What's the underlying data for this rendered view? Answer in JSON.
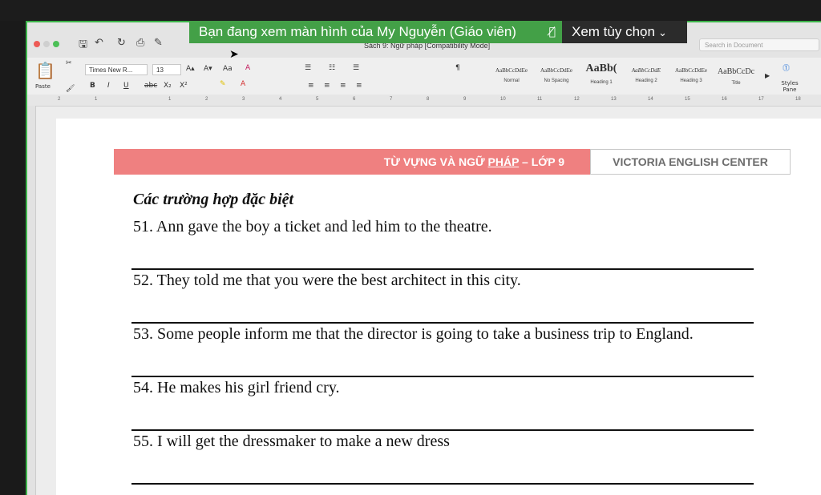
{
  "share_banner": {
    "text": "Bạn đang xem màn hình của My Nguyễn (Giáo viên)",
    "mic_icon": "mic-muted-icon",
    "view_options": "Xem tùy chọn",
    "accent": "#43a047"
  },
  "window": {
    "title": "Sách 9: Ngữ pháp [Compatibility Mode]",
    "search_placeholder": "Search in Document"
  },
  "ribbon": {
    "paste": "Paste",
    "font_name": "Times New R...",
    "font_size": "13",
    "bold": "B",
    "italic": "I",
    "underline": "U",
    "strike": "abc",
    "subscript": "X₂",
    "superscript": "X²",
    "styles": [
      {
        "sample": "AaBbCcDdEe",
        "label": "Normal"
      },
      {
        "sample": "AaBbCcDdEe",
        "label": "No Spacing"
      },
      {
        "sample": "AaBb(",
        "label": "Heading 1"
      },
      {
        "sample": "AaBbCcDdE",
        "label": "Heading 2"
      },
      {
        "sample": "AaBbCcDdEe",
        "label": "Heading 3"
      },
      {
        "sample": "AaBbCcDc",
        "label": "Title"
      }
    ],
    "styles_pane": "Styles Pane"
  },
  "ruler": {
    "numbers": [
      "2",
      "1",
      "1",
      "2",
      "3",
      "4",
      "5",
      "6",
      "7",
      "8",
      "9",
      "10",
      "11",
      "12",
      "13",
      "14",
      "15",
      "16",
      "17",
      "18"
    ]
  },
  "document": {
    "header_left": "TỪ VỰNG VÀ NGỮ PHÁP – LỚP 9",
    "header_left_pre": "TỪ VỰNG VÀ NGỮ ",
    "header_left_ul": "PHÁP",
    "header_left_post": " – LỚP 9",
    "header_right": "VICTORIA ENGLISH CENTER",
    "header_color": "#ef8080",
    "section": "Các trường hợp đặc biệt",
    "items": [
      "51. Ann gave the boy a ticket and led him to the theatre.",
      "52. They told me that you were the best architect in this city.",
      "53. Some people inform me that the director is going to take a business trip to England.",
      "54. He makes his girl friend cry.",
      "55. I will get the dressmaker to make a new dress"
    ]
  }
}
